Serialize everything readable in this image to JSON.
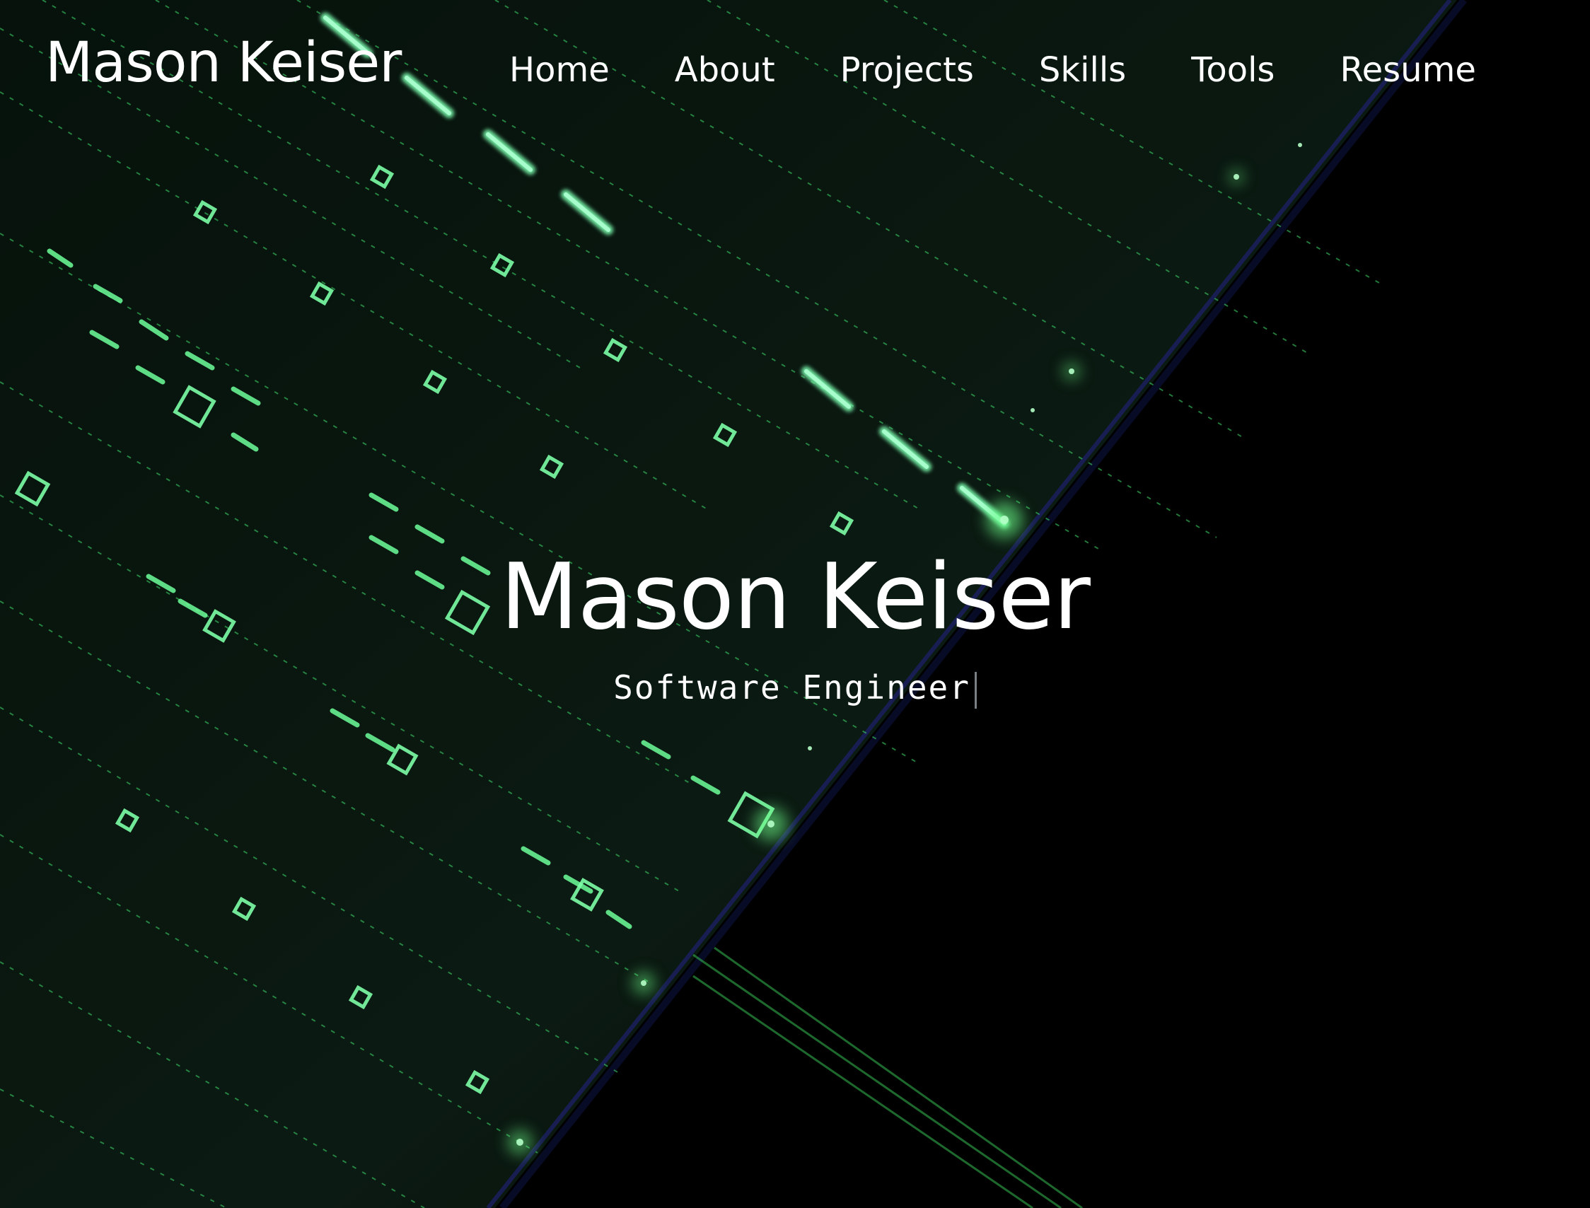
{
  "brand": "Mason Keiser",
  "nav": {
    "items": [
      "Home",
      "About",
      "Projects",
      "Skills",
      "Tools",
      "Resume"
    ]
  },
  "hero": {
    "title": "Mason Keiser",
    "subtitle": "Software Engineer"
  },
  "colors": {
    "background": "#000000",
    "text": "#ffffff",
    "accent_glow": "#7dff9a"
  }
}
